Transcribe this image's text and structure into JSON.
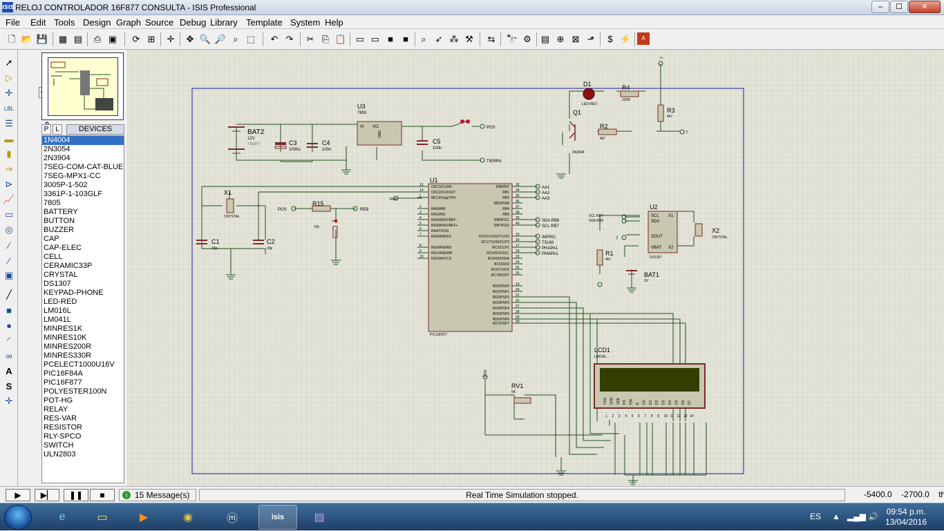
{
  "window": {
    "title": "RELOJ CONTROLADOR 16F877 CONSULTA - ISIS Professional",
    "app_icon": "ISIS",
    "min": "–",
    "max": "☐",
    "close": "✕"
  },
  "menu": [
    "File",
    "Edit",
    "Tools",
    "Design",
    "Graph",
    "Source",
    "Debug",
    "Library",
    "Template",
    "System",
    "Help"
  ],
  "rotation": {
    "angle": "0°"
  },
  "devices": {
    "tab_p": "P",
    "tab_l": "L",
    "header": "DEVICES",
    "items": [
      "1N4004",
      "2N3054",
      "2N3904",
      "7SEG-COM-CAT-BLUE",
      "7SEG-MPX1-CC",
      "3005P-1-502",
      "3361P-1-103GLF",
      "7805",
      "BATTERY",
      "BUTTON",
      "BUZZER",
      "CAP",
      "CAP-ELEC",
      "CELL",
      "CERAMIC33P",
      "CRYSTAL",
      "DS1307",
      "KEYPAD-PHONE",
      "LED-RED",
      "LM016L",
      "LM041L",
      "MINRES1K",
      "MINRES10K",
      "MINRES200R",
      "MINRES330R",
      "PCELECT1000U16V",
      "PIC16F84A",
      "PIC16F877",
      "POLYESTER100N",
      "POT-HG",
      "RELAY",
      "RES-VAR",
      "RESISTOR",
      "RLY-SPCO",
      "SWITCH",
      "ULN2803"
    ],
    "selected": "1N4004"
  },
  "schematic": {
    "labels": {
      "bat2": "BAT2",
      "bat2_val": "12V",
      "c3": "C3",
      "c3_val": "1000u",
      "c4": "C4",
      "c4_val": "100n",
      "u3": "U3",
      "u3_part": "7805",
      "vi": "VI",
      "vo": "VO",
      "gnd": "GND",
      "c5": "C5",
      "c5_val": "100n",
      "pos": "POS",
      "tierra": "TIERRA",
      "d1": "D1",
      "led": "LED-RED",
      "r4": "R4",
      "r4_val": "220R",
      "r3": "R3",
      "r3_val": "4k7",
      "q1": "Q1",
      "q1_part": "2N3904",
      "r2": "R2",
      "r2_val": "4k7",
      "u1": "U1",
      "u1_part": "PIC16F877",
      "x1": "X1",
      "crystal": "CRYSTAL",
      "c1": "C1",
      "c1_val": "33p",
      "c2": "C2",
      "c2_val": "33p",
      "r15": "R15",
      "r15_val": "10k",
      "reb": "REB",
      "u2": "U2",
      "u2_part": "DS1307",
      "x2": "X2",
      "r1": "R1",
      "r1_val": "4k7",
      "bat1": "BAT1",
      "bat1_val": "3V",
      "sclrb7": "SCL RB7",
      "sdarb6": "SDA RB6",
      "seven": "7",
      "two": "2",
      "lcd1": "LCD1",
      "lcd_part": "LM016L",
      "rv1": "RV1",
      "rv1_val": "5K",
      "text": "<TEXT>",
      "aa1": "AA1",
      "aa2": "AA2",
      "aa3": "AA3",
      "sdarb6r": "SDA RB6",
      "sclrb7r": "SCL RB7",
      "impro": "IMPRO",
      "tsum": "TSUM",
      "phapa1": "PHAPA1",
      "pmapa1": "PMAPA1"
    },
    "pic_left": [
      "OSC1/CLKIN",
      "OSC2/CLKOUT",
      "MCLR/Vpp/THV",
      "RA0/AN0",
      "RA1/AN1",
      "RA2/AN2/VREF-",
      "RA3/AN3/VREF+",
      "RA4/T0CKI",
      "RA5/AN4/SS",
      "RE0/AN5/RD",
      "RE1/AN6/WR",
      "RE2/AN7/CS"
    ],
    "pic_left_pins": [
      "13",
      "14",
      "1",
      "2",
      "3",
      "4",
      "5",
      "6",
      "7",
      "8",
      "9",
      "10"
    ],
    "pic_right": [
      "RB0/INT",
      "RB1",
      "RB2",
      "RB3/PGM",
      "RB4",
      "RB5",
      "RB6/PGC",
      "RB7/PGD",
      "RC0/T1OSO/T1CKI",
      "RC1/T1OSI/CCP2",
      "RC2/CCP1",
      "RC3/SCK/SCL",
      "RC4/SDI/SDA",
      "RC5/SDO",
      "RC6/TX/CK",
      "RC7/RX/DT",
      "RD0/PSP0",
      "RD1/PSP1",
      "RD2/PSP2",
      "RD3/PSP3",
      "RD4/PSP4",
      "RD5/PSP5",
      "RD6/PSP6",
      "RD7/PSP7"
    ],
    "pic_right_pins": [
      "33",
      "34",
      "35",
      "36",
      "37",
      "38",
      "39",
      "40",
      "15",
      "16",
      "17",
      "18",
      "23",
      "24",
      "25",
      "26",
      "19",
      "20",
      "21",
      "22",
      "27",
      "28",
      "29",
      "30"
    ],
    "lcd_pins": [
      "VSS",
      "VDD",
      "VEE",
      "RS",
      "RW",
      "E",
      "D0",
      "D1",
      "D2",
      "D3",
      "D4",
      "D5",
      "D6",
      "D7"
    ],
    "lcd_nums": [
      "1",
      "2",
      "3",
      "4",
      "5",
      "6",
      "7",
      "8",
      "9",
      "10",
      "11",
      "12",
      "13",
      "14"
    ],
    "ds_left": [
      "SCL",
      "SDA",
      "SOUT",
      "VBAT"
    ],
    "ds_right": [
      "X1",
      "X2"
    ]
  },
  "status": {
    "messages": "15 Message(s)",
    "sim": "Real Time Simulation stopped.",
    "coord_x": "-5400.0",
    "coord_y": "-2700.0",
    "unit": "th"
  },
  "tray": {
    "lang": "ES",
    "time": "09:54 p.m.",
    "date": "13/04/2016"
  }
}
